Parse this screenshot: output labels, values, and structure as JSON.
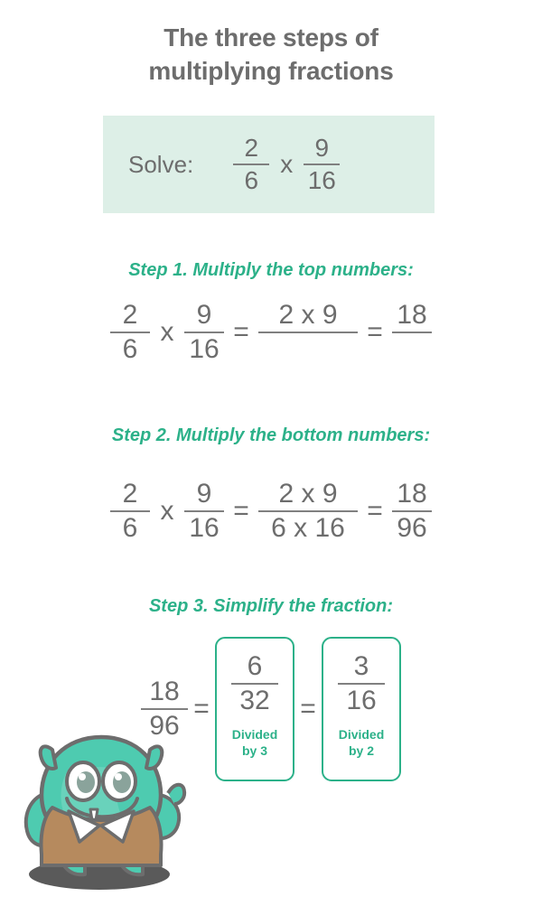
{
  "title": {
    "line1": "The three steps of",
    "line2": "multiplying fractions"
  },
  "solve": {
    "label": "Solve:",
    "fraction_a": {
      "numerator": "2",
      "denominator": "6"
    },
    "operator": "x",
    "fraction_b": {
      "numerator": "9",
      "denominator": "16"
    }
  },
  "steps": [
    {
      "heading": "Step 1. Multiply the top numbers:",
      "fraction_a": {
        "numerator": "2",
        "denominator": "6"
      },
      "op_multiply": "x",
      "fraction_b": {
        "numerator": "9",
        "denominator": "16"
      },
      "op_equals_1": "=",
      "fraction_product": {
        "numerator": "2 x 9",
        "denominator": ""
      },
      "op_equals_2": "=",
      "fraction_result": {
        "numerator": "18",
        "denominator": ""
      }
    },
    {
      "heading": "Step 2. Multiply the bottom numbers:",
      "fraction_a": {
        "numerator": "2",
        "denominator": "6"
      },
      "op_multiply": "x",
      "fraction_b": {
        "numerator": "9",
        "denominator": "16"
      },
      "op_equals_1": "=",
      "fraction_product": {
        "numerator": "2 x 9",
        "denominator": "6 x 16"
      },
      "op_equals_2": "=",
      "fraction_result": {
        "numerator": "18",
        "denominator": "96"
      }
    },
    {
      "heading": "Step 3. Simplify the fraction:",
      "fraction_start": {
        "numerator": "18",
        "denominator": "96"
      },
      "op_equals_1": "=",
      "box_1": {
        "numerator": "6",
        "denominator": "32",
        "note_line1": "Divided",
        "note_line2": "by 3"
      },
      "op_equals_2": "=",
      "box_2": {
        "numerator": "3",
        "denominator": "16",
        "note_line1": "Divided",
        "note_line2": "by 2"
      }
    }
  ],
  "mascot": {
    "name": "monster-mascot",
    "body_color": "#4ecbb0",
    "jacket_color": "#b68a5e",
    "outline_color": "#6d6d6d",
    "collar_color": "#ffffff",
    "shadow_color": "#5a5a5a"
  },
  "colors": {
    "accent_teal": "#2cb189",
    "text_gray": "#6d6d6d",
    "panel_mint": "#ddefe7",
    "rule_gray": "#808080"
  }
}
